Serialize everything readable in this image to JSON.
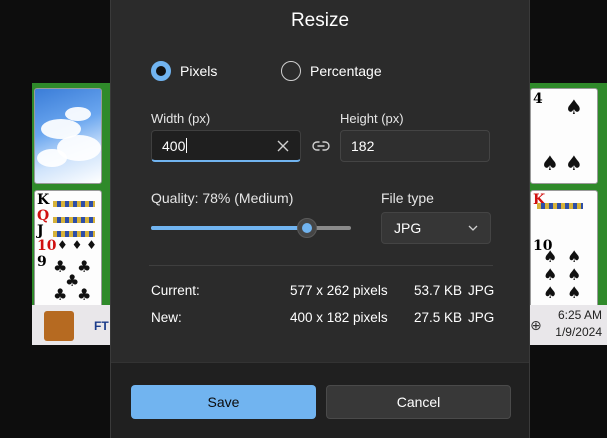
{
  "dialog": {
    "title": "Resize",
    "mode_options": [
      {
        "label": "Pixels",
        "selected": true
      },
      {
        "label": "Percentage",
        "selected": false
      }
    ],
    "width_label": "Width  (px)",
    "width_value": "400",
    "height_label": "Height  (px)",
    "height_value": "182",
    "quality_label": "Quality: 78% (Medium)",
    "quality_percent": 78,
    "file_type_label": "File type",
    "file_type_value": "JPG",
    "info": {
      "current": {
        "label": "Current:",
        "dimensions": "577 x 262 pixels",
        "size": "53.7 KB",
        "format": "JPG"
      },
      "new": {
        "label": "New:",
        "dimensions": "400 x 182 pixels",
        "size": "27.5 KB",
        "format": "JPG"
      }
    },
    "save_label": "Save",
    "cancel_label": "Cancel"
  },
  "background": {
    "clock_time": "6:25 AM",
    "clock_date": "1/9/2024",
    "card_ranks_left": [
      "K",
      "Q",
      "J",
      "10",
      "9"
    ],
    "card_ranks_right": [
      "4",
      "K",
      "10"
    ],
    "taskbar_text": "FT",
    "colors": {
      "felt_green": "#2f8a2a",
      "accent": "#71b4f0",
      "dialog_bg": "#2b2b2b"
    }
  }
}
